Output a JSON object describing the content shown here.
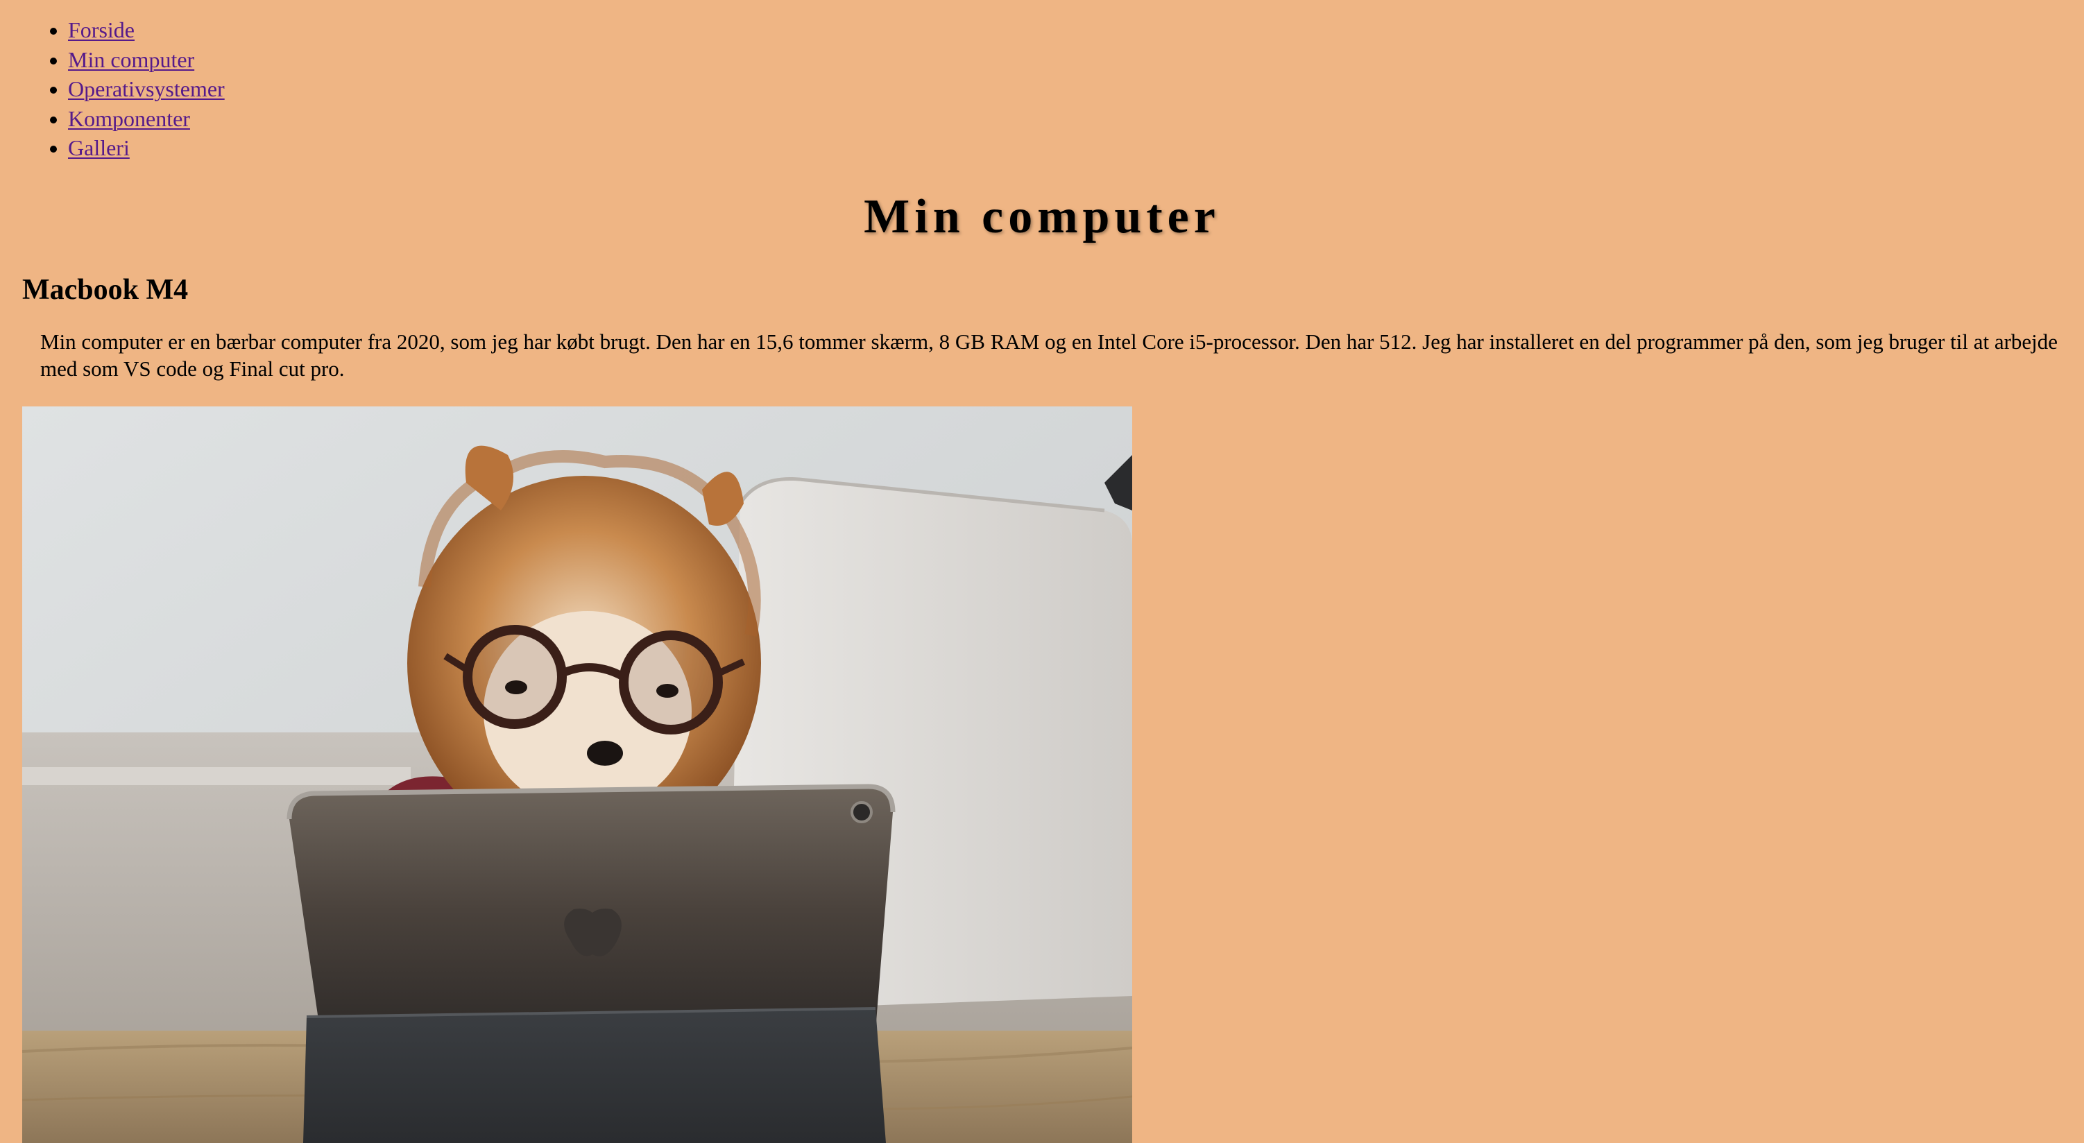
{
  "nav": {
    "items": [
      {
        "label": "Forside"
      },
      {
        "label": "Min computer"
      },
      {
        "label": "Operativsystemer"
      },
      {
        "label": "Komponenter"
      },
      {
        "label": "Galleri"
      }
    ]
  },
  "page": {
    "title": "Min computer",
    "subtitle": "Macbook M4",
    "description": "Min computer er en bærbar computer fra 2020, som jeg har købt brugt. Den har en 15,6 tommer skærm, 8 GB RAM og en Intel Core i5-processor. Den har 512. Jeg har installeret en del programmer på den, som jeg bruger til at arbejde med som VS code og Final cut pro."
  },
  "colors": {
    "background": "#efb584",
    "link": "#551a8b"
  }
}
